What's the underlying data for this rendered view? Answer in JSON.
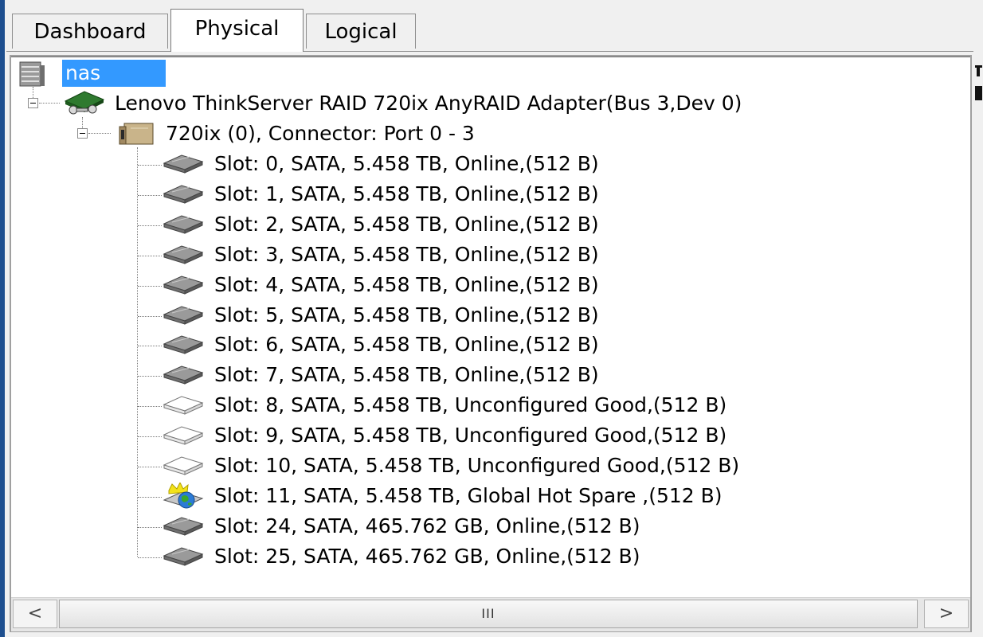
{
  "tabs": [
    {
      "label": "Dashboard",
      "active": false
    },
    {
      "label": "Physical",
      "active": true
    },
    {
      "label": "Logical",
      "active": false
    }
  ],
  "tree": {
    "root": {
      "label": "nas",
      "icon": "server-icon",
      "selected": true
    },
    "adapter": {
      "label": "Lenovo ThinkServer RAID 720ix AnyRAID Adapter(Bus 3,Dev 0)",
      "icon": "raid-adapter-icon",
      "expanded": true
    },
    "connector": {
      "label": "720ix (0), Connector: Port 0 - 3",
      "icon": "enclosure-icon",
      "expanded": true
    },
    "drives": [
      {
        "label": "Slot: 0, SATA, 5.458 TB, Online,(512 B)",
        "state": "online"
      },
      {
        "label": "Slot: 1, SATA, 5.458 TB, Online,(512 B)",
        "state": "online"
      },
      {
        "label": "Slot: 2, SATA, 5.458 TB, Online,(512 B)",
        "state": "online"
      },
      {
        "label": "Slot: 3, SATA, 5.458 TB, Online,(512 B)",
        "state": "online"
      },
      {
        "label": "Slot: 4, SATA, 5.458 TB, Online,(512 B)",
        "state": "online"
      },
      {
        "label": "Slot: 5, SATA, 5.458 TB, Online,(512 B)",
        "state": "online"
      },
      {
        "label": "Slot: 6, SATA, 5.458 TB, Online,(512 B)",
        "state": "online"
      },
      {
        "label": "Slot: 7, SATA, 5.458 TB, Online,(512 B)",
        "state": "online"
      },
      {
        "label": "Slot: 8, SATA, 5.458 TB, Unconfigured Good,(512 B)",
        "state": "unconfigured"
      },
      {
        "label": "Slot: 9, SATA, 5.458 TB, Unconfigured Good,(512 B)",
        "state": "unconfigured"
      },
      {
        "label": "Slot: 10, SATA, 5.458 TB, Unconfigured Good,(512 B)",
        "state": "unconfigured"
      },
      {
        "label": "Slot: 11, SATA, 5.458 TB, Global Hot Spare ,(512 B)",
        "state": "hotspare"
      },
      {
        "label": "Slot: 24, SATA, 465.762 GB, Online,(512 B)",
        "state": "online"
      },
      {
        "label": "Slot: 25, SATA, 465.762 GB, Online,(512 B)",
        "state": "online"
      }
    ]
  },
  "scrollbar": {
    "left_arrow": "<",
    "right_arrow": ">",
    "grip": "III"
  },
  "colors": {
    "selection": "#3399ff",
    "window_edge": "#1e4f8f",
    "drive_online": "#8a8a8a",
    "drive_unconfigured": "#ffffff"
  }
}
